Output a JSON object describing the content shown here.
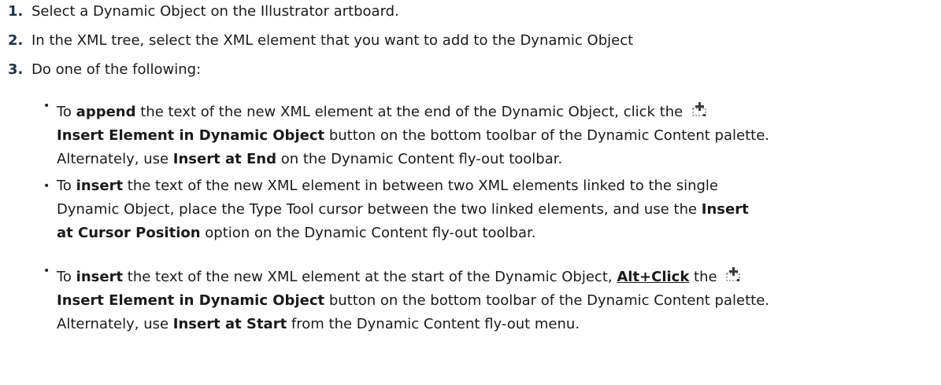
{
  "steps": [
    {
      "number": "1.",
      "text": "Select a Dynamic Object on the Illustrator artboard."
    },
    {
      "number": "2.",
      "text": "In the XML tree, select the XML element that you want to add to the Dynamic Object"
    },
    {
      "number": "3.",
      "text": "Do one of the following:"
    }
  ],
  "options": [
    {
      "bullet": "•",
      "l1_a": "To ",
      "l1_b": "append",
      "l1_c": " the text of the new XML element at the end of the Dynamic Object, click the",
      "icon": "insert-element-icon",
      "l2_a": "Insert Element in Dynamic Object",
      "l2_b": " button on the bottom toolbar of the Dynamic Content palette.",
      "l3_a": "Alternately, use ",
      "l3_b": "Insert at End",
      "l3_c": " on the Dynamic Content fly-out toolbar."
    },
    {
      "bullet": "•",
      "l1_a": "To ",
      "l1_b": "insert",
      "l1_c": " the text of the new XML element in between two XML elements linked to the single",
      "l2_a": "Dynamic Object, place the Type Tool cursor between the two linked elements, and use the ",
      "l2_b": "Insert",
      "l3_a": "at Cursor Position",
      "l3_b": " option on the Dynamic Content fly-out toolbar."
    },
    {
      "bullet": "•",
      "l1_a": "To ",
      "l1_b": "insert",
      "l1_c": " the text of the new XML element at the start of the Dynamic Object, ",
      "l1_d": "Alt+Click",
      "l1_e": " the",
      "icon": "insert-element-icon",
      "l2_a": "Insert Element in Dynamic Object",
      "l2_b": " button on the bottom toolbar of the Dynamic Content palette.",
      "l3_a": "Alternately, use ",
      "l3_b": "Insert at Start",
      "l3_c": " from the Dynamic Content fly-out menu."
    }
  ],
  "colors": {
    "number": "#1f3349",
    "text": "#1a1a1a",
    "icon_plus": "#3a3a3a"
  }
}
